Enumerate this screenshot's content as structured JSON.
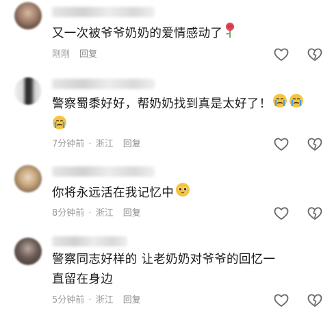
{
  "comments": [
    {
      "text": "又一次被爷爷奶奶的爱情感动了",
      "time": "刚刚",
      "location": "",
      "reply_label": "回复",
      "emojis": [
        "rose-emoji"
      ],
      "avatar_colors": [
        "#7a5a4a",
        "#d8b8a0",
        "#3a2a24"
      ]
    },
    {
      "text": "警察蜀黍好好，帮奶奶找到真是太好了！",
      "time": "7分钟前",
      "location": "浙江",
      "reply_label": "回复",
      "emojis": [
        "crying-face-emoji",
        "crying-face-emoji",
        "crying-face-emoji"
      ],
      "avatar_colors": [
        "#2a2a2a",
        "#9a9a9a",
        "#dcdcdc"
      ]
    },
    {
      "text": "你将永远活在我记忆中",
      "time": "8分钟前",
      "location": "浙江",
      "reply_label": "回复",
      "emojis": [
        "pleading-face-emoji"
      ],
      "avatar_colors": [
        "#c9a77a",
        "#5a4a40",
        "#e8d8c8"
      ]
    },
    {
      "text": "警察同志好样的 让老奶奶对爷爷的回忆一直留在身边",
      "time": "5分钟前",
      "location": "浙江",
      "reply_label": "回复",
      "emojis": [],
      "avatar_colors": [
        "#3a3030",
        "#b8a8a0",
        "#6a5a55"
      ]
    }
  ],
  "colors": {
    "text": "#1a1a1a",
    "meta": "#9a9a9a",
    "icon": "#666666"
  }
}
